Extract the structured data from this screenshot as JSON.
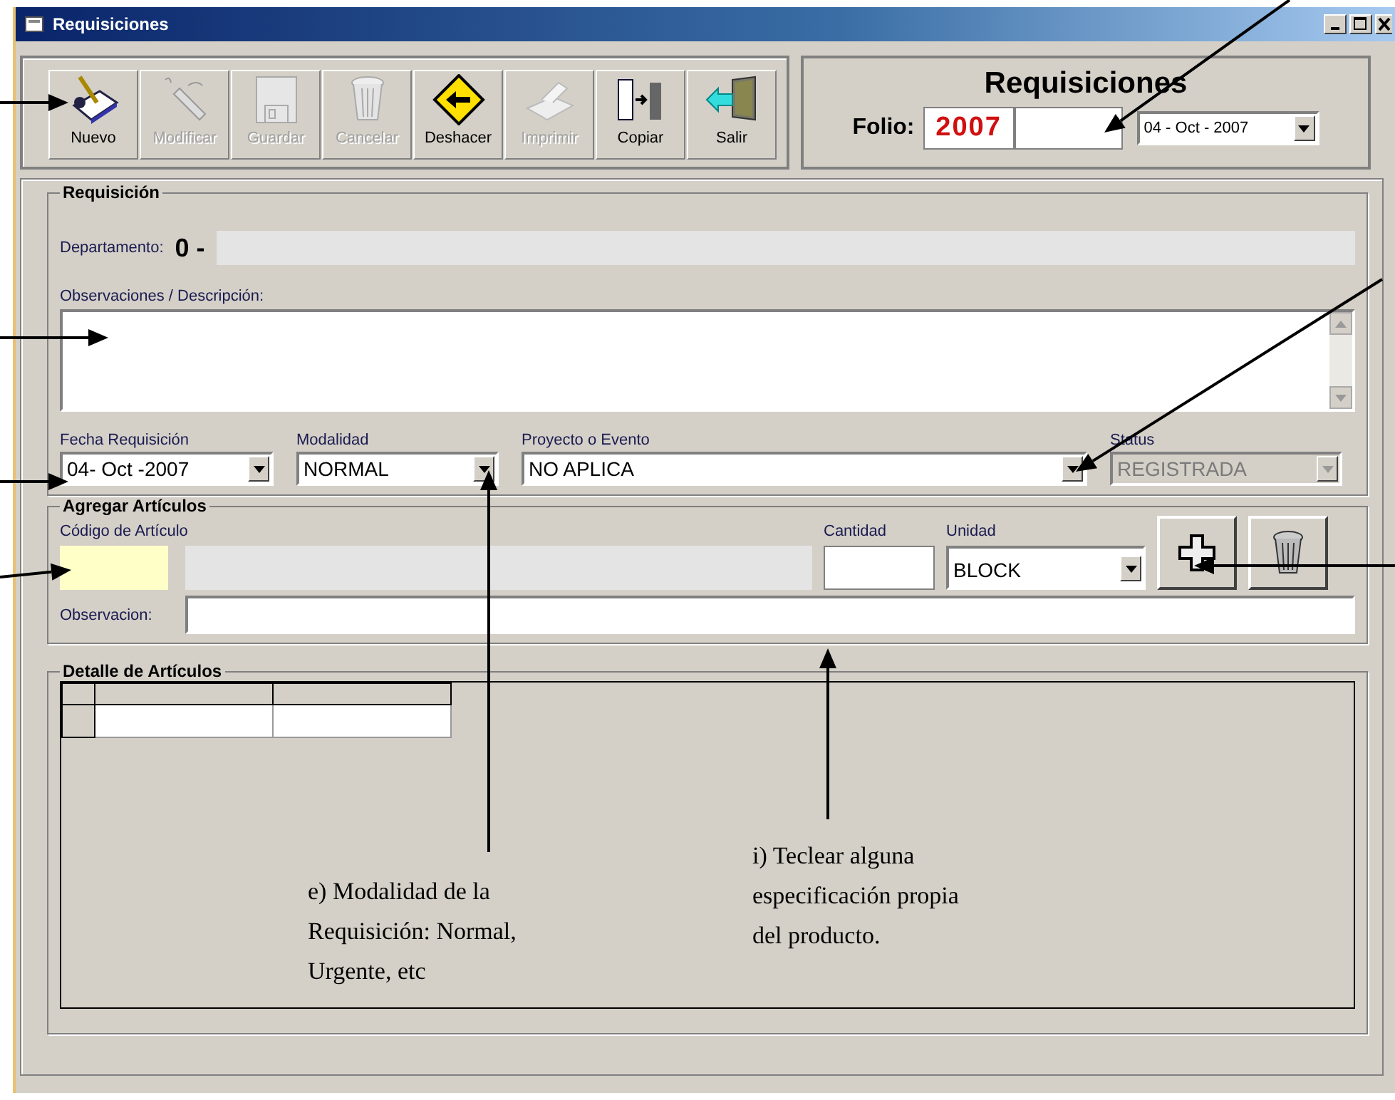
{
  "window": {
    "title": "Requisiciones"
  },
  "toolbar": [
    {
      "kind": "new",
      "label": "Nuevo",
      "disabled": false
    },
    {
      "kind": "edit",
      "label": "Modificar",
      "disabled": true
    },
    {
      "kind": "save",
      "label": "Guardar",
      "disabled": true
    },
    {
      "kind": "cancel",
      "label": "Cancelar",
      "disabled": true
    },
    {
      "kind": "undo",
      "label": "Deshacer",
      "disabled": false
    },
    {
      "kind": "print",
      "label": "Imprimir",
      "disabled": true
    },
    {
      "kind": "copy",
      "label": "Copiar",
      "disabled": false
    },
    {
      "kind": "exit",
      "label": "Salir",
      "disabled": false
    }
  ],
  "header": {
    "title": "Requisiciones",
    "folio_label": "Folio:",
    "folio_year": "2007",
    "date": "04 - Oct - 2007"
  },
  "requisicion": {
    "legend": "Requisición",
    "department_label": "Departamento:",
    "department_value": "0 -",
    "observations_label": "Observaciones / Descripción:",
    "fields": [
      {
        "label": "Fecha Requisición",
        "value": "04- Oct -2007",
        "disabled": false
      },
      {
        "label": "Modalidad",
        "value": "NORMAL",
        "disabled": false
      },
      {
        "label": "Proyecto o  Evento",
        "value": "NO APLICA",
        "disabled": false
      },
      {
        "label": "Status",
        "value": "REGISTRADA",
        "disabled": true
      }
    ]
  },
  "agregar": {
    "legend": "Agregar Artículos",
    "code_label": "Código de Artículo",
    "quantity_label": "Cantidad",
    "unit_label": "Unidad",
    "unit_value": "BLOCK",
    "observation_label": "Observacion:"
  },
  "detalle": {
    "legend": "Detalle de Artículos"
  },
  "annotations": [
    {
      "text": "e) Modalidad de la Requisición: Normal, Urgente, etc"
    },
    {
      "text": "i) Teclear alguna especificación propia  del producto."
    }
  ]
}
